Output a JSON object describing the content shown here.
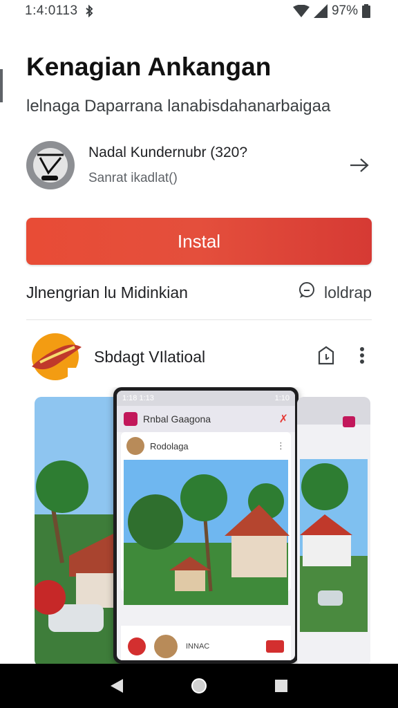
{
  "status_bar": {
    "time": "1:4:0113",
    "bluetooth_icon": "bluetooth-icon",
    "battery_text": "97%"
  },
  "header": {
    "title": "Kenagian Ankangan",
    "subtitle": "lelnaga Daparrana lanabisdahanarbaigaa"
  },
  "developer": {
    "name": "Nadal Kundernubr (320?",
    "sub": "Sanrat ikadlat()",
    "arrow_icon": "arrow-right-icon"
  },
  "install_button": {
    "label": "Instal",
    "color": "#e44f3c"
  },
  "info_row": {
    "left_text": "Jlnengrian lu Midinkian",
    "right_text": "loldrap",
    "right_icon": "chat-bubble-icon"
  },
  "app_row": {
    "name": "Sbdagt VIlatioal",
    "share_icon": "share-icon",
    "more_icon": "more-vert-icon"
  },
  "screenshot": {
    "status_time": "1:18 1:13",
    "status_right": "1:10",
    "app_title": "Rnbal Gaagona",
    "post_user": "Rodolaga",
    "footer_text": "INNAC"
  },
  "nav": {
    "back_icon": "back-triangle-icon",
    "home_icon": "home-circle-icon",
    "recents_icon": "recents-square-icon"
  }
}
